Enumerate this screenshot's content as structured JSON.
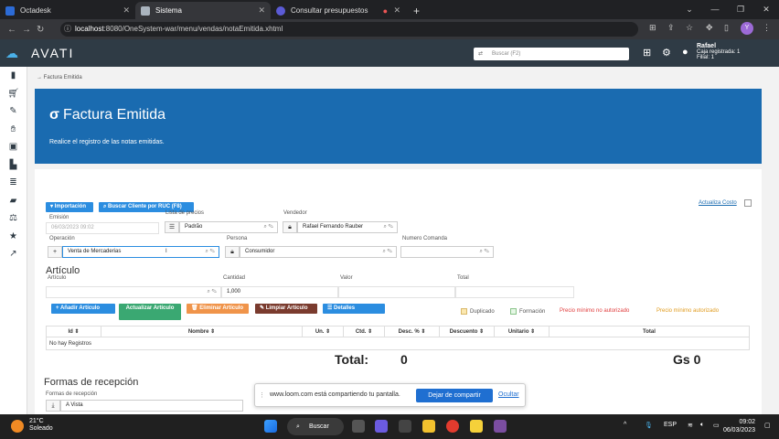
{
  "browser": {
    "tabs": [
      {
        "label": "Octadesk",
        "fav": "#2c6bd6",
        "active": false
      },
      {
        "label": "Sistema",
        "fav": "#aab4be",
        "active": true
      },
      {
        "label": "Consultar presupuestos",
        "fav": "#5b5bd6",
        "active": false
      }
    ],
    "url_host": "localhost",
    "url_path": ":8080/OneSystem-war/menu/vendas/notaEmitida.xhtml"
  },
  "header": {
    "logo": "AVATI",
    "search_placeholder": "Buscar (F2)",
    "user_name": "Rafael",
    "user_line1": "Caja registrada: 1",
    "user_line2": "Filial: 1"
  },
  "breadcrumb": "Factura Emitida",
  "banner": {
    "title": "Factura Emitida",
    "subtitle": "Realice el registro de las notas emitidas."
  },
  "toolbar": {
    "importacion": "▾ Importación",
    "buscar_cliente": "Buscar Cliente por RUC (F8)",
    "actualiza_costo": "Actualiza Costo"
  },
  "form": {
    "emision_label": "Emisión",
    "emision_value": "06/03/2023 09:02",
    "lista_label": "Lista de precios",
    "lista_value": "Padrão",
    "vendedor_label": "Vendedor",
    "vendedor_value": "Rafael Fernando Rauber",
    "operacion_label": "Operación",
    "operacion_value": "Venta de Mercaderias",
    "persona_label": "Persona",
    "persona_value": "Consumidor",
    "comanda_label": "Numero Comanda"
  },
  "articulo": {
    "heading": "Artículo",
    "articulo_label": "Artículo",
    "cantidad_label": "Cantidad",
    "cantidad_value": "1,000",
    "valor_label": "Valor",
    "total_label": "Total"
  },
  "actions": {
    "anadir": "Añadir Artículo",
    "actualizar": "Actualizar Artículo",
    "eliminar": "Eliminar Artículo",
    "limpiar": "Limpiar Artículo",
    "detalles": "Detalles"
  },
  "legend": {
    "duplicado": "Duplicado",
    "formacion": "Formación",
    "no_autorizado": "Precio mínimo no autorizado",
    "autorizado": "Precio mínimo autorizado"
  },
  "table": {
    "headers": [
      "Id",
      "Nombre",
      "Un.",
      "Ctd.",
      "Desc. %",
      "Descuento",
      "Unitario",
      "Total"
    ],
    "empty": "No hay Registros"
  },
  "totals": {
    "label": "Total:",
    "qty": "0",
    "amount": "Gs 0"
  },
  "formas": {
    "heading": "Formas de recepción",
    "field_label": "Formas de recepción",
    "value": "A Vista"
  },
  "loom": {
    "text": "www.loom.com está compartiendo tu pantalla.",
    "stop": "Dejar de compartir",
    "hide": "Ocultar"
  },
  "taskbar": {
    "temp": "21°C",
    "weather": "Soleado",
    "search": "Buscar",
    "lang": "ESP",
    "time": "09:02",
    "date": "06/03/2023"
  },
  "colors": {
    "banner": "#1a6bb0",
    "header": "#2f3b45",
    "btn_blue": "#2b8de0",
    "btn_green": "#3aa872",
    "btn_orange": "#f0944a",
    "btn_brown": "#7a3b2e"
  }
}
